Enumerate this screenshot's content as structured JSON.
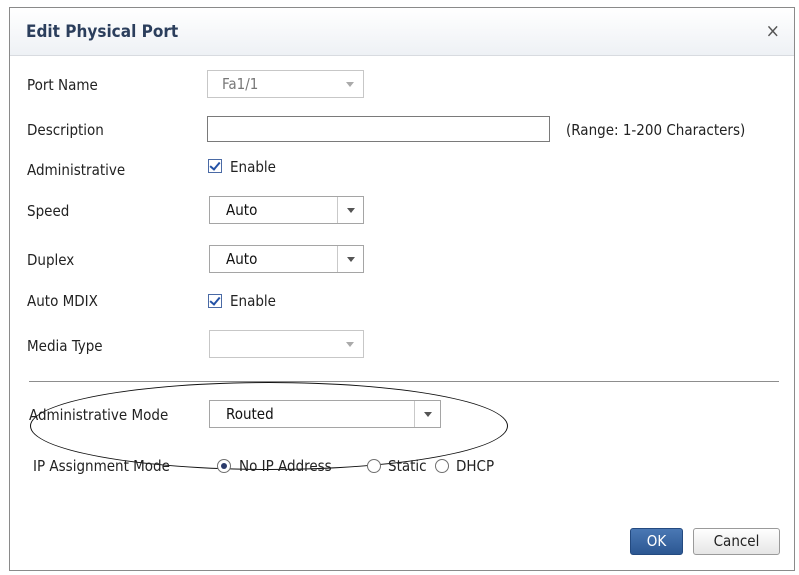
{
  "dialog": {
    "title": "Edit Physical Port",
    "close_glyph": "×"
  },
  "form": {
    "port_name": {
      "label": "Port Name",
      "value": "Fa1/1"
    },
    "description": {
      "label": "Description",
      "value": "",
      "hint": "(Range: 1-200 Characters)"
    },
    "administrative": {
      "label": "Administrative",
      "checkbox_label": "Enable",
      "checked": true
    },
    "speed": {
      "label": "Speed",
      "value": "Auto"
    },
    "duplex": {
      "label": "Duplex",
      "value": "Auto"
    },
    "auto_mdix": {
      "label": "Auto MDIX",
      "checkbox_label": "Enable",
      "checked": true
    },
    "media_type": {
      "label": "Media Type",
      "value": ""
    },
    "administrative_mode": {
      "label": "Administrative Mode",
      "value": "Routed"
    },
    "ip_assignment_mode": {
      "label": "IP Assignment Mode",
      "options": [
        {
          "label": "No IP Address",
          "selected": true
        },
        {
          "label": "Static",
          "selected": false
        },
        {
          "label": "DHCP",
          "selected": false
        }
      ]
    }
  },
  "buttons": {
    "ok_label": "OK",
    "cancel_label": "Cancel"
  },
  "colors": {
    "title_text": "#2b3e5c",
    "ok_button": "#2c5792",
    "annotation_ellipse": "#111111"
  }
}
